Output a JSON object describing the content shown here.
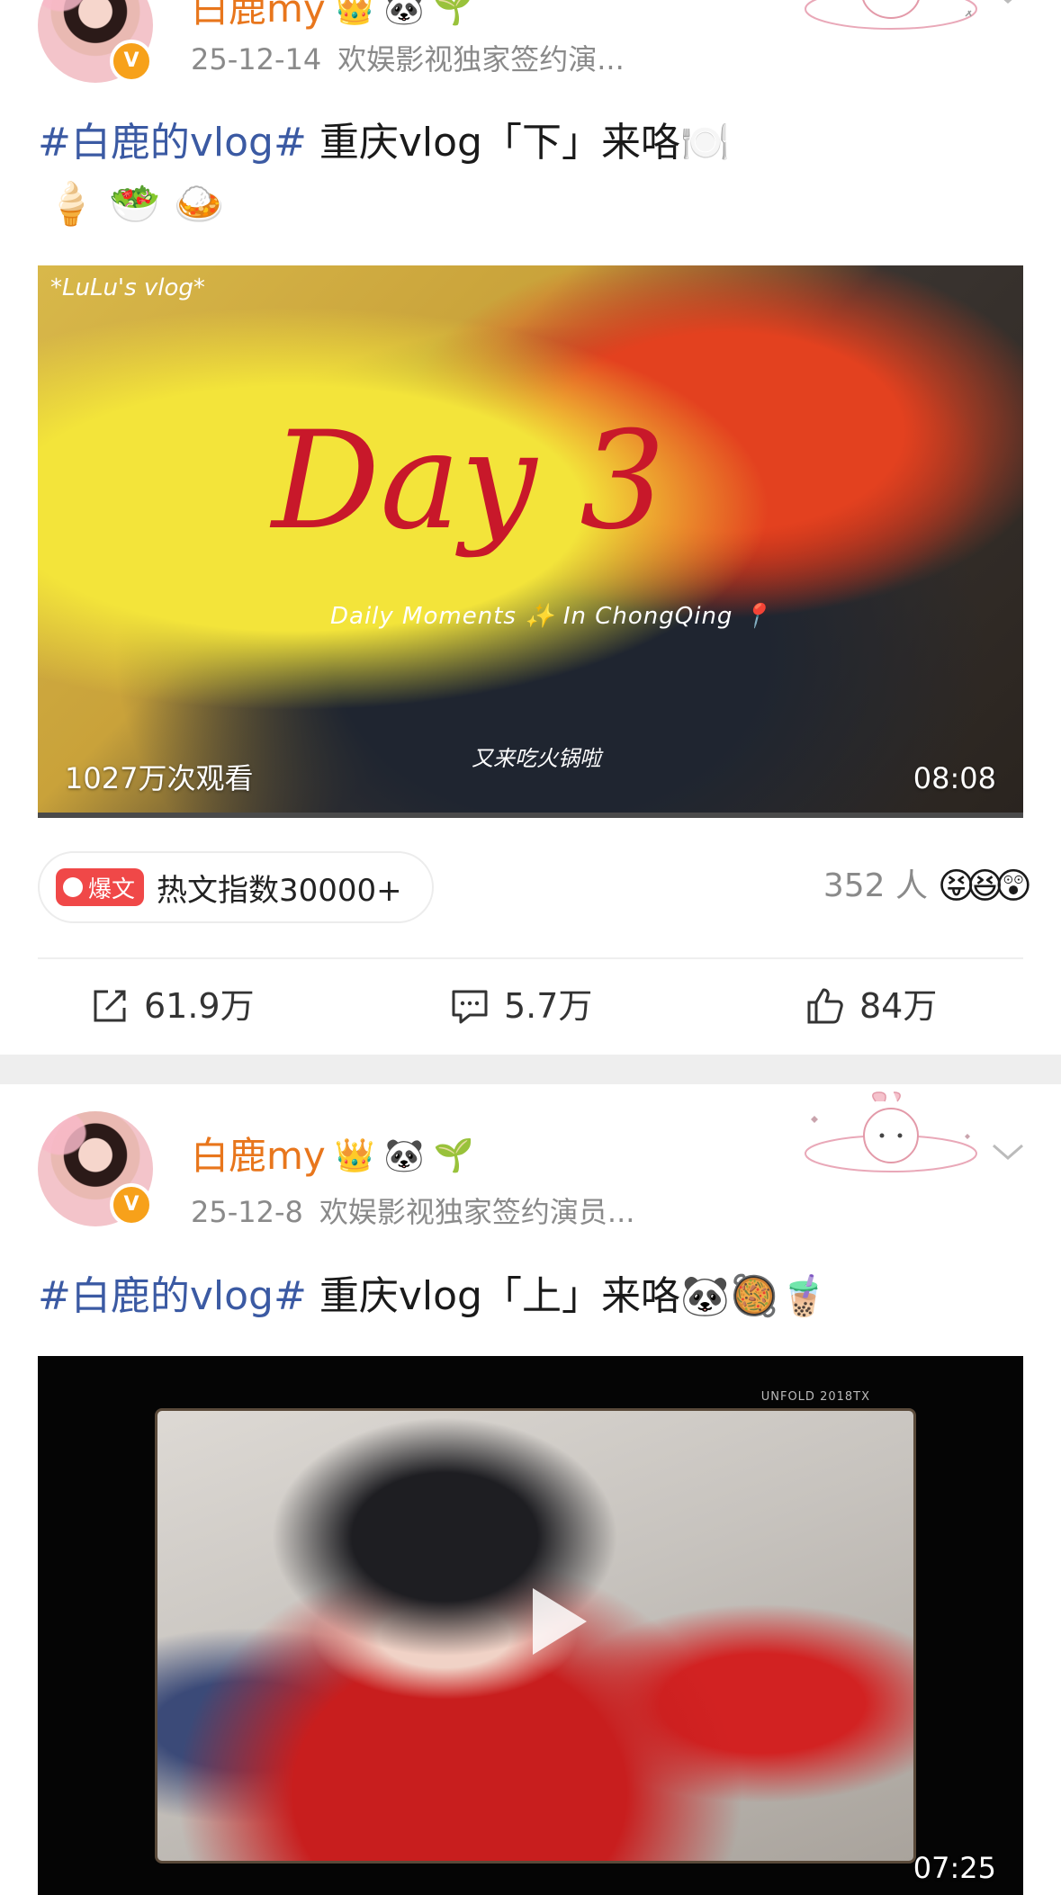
{
  "post1": {
    "nickname": "白鹿my",
    "nickname_emojis": [
      "👑",
      "🐼",
      "🌱"
    ],
    "date": "25-12-14",
    "source": "欢娱影视独家签约演...",
    "topic": "#白鹿的vlog#",
    "caption_text": " 重庆vlog「下」来咯🍽️",
    "emoji_line": "🍦🥗🍛",
    "video": {
      "corner_text": "*LuLu's vlog*",
      "title_text": "Day 3",
      "subtitle_en": "Daily Moments ✨ In ChongQing 📍",
      "subtitle_cn": "又来吃火锅啦",
      "views": "1027万次观看",
      "duration": "08:08"
    },
    "hot_badge": "爆文",
    "hot_text": "热文指数30000+",
    "people": "352 人",
    "reactions": "😝😆😲",
    "actions": {
      "repost": "61.9万",
      "comment": "5.7万",
      "like": "84万"
    }
  },
  "post2": {
    "nickname": "白鹿my",
    "nickname_emojis": [
      "👑",
      "🐼",
      "🌱"
    ],
    "date": "25-12-8",
    "source": "欢娱影视独家签约演员...",
    "topic": "#白鹿的vlog#",
    "caption_text": " 重庆vlog「上」来咯🐼🥘🧋",
    "video": {
      "film_code": "UNFOLD 2018TX",
      "duration": "07:25"
    }
  },
  "colors": {
    "nickname": "#e8761c",
    "topic": "#3b5aa3",
    "hot_badge": "#f04848",
    "meta": "#8a8a8a"
  }
}
